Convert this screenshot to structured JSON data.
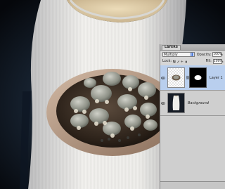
{
  "panel": {
    "tab_label": "LAYERS",
    "blend_mode": "Multiply",
    "opacity_label": "Opacity:",
    "opacity_value": "100%",
    "lock_label": "Lock:",
    "fill_label": "Fill:",
    "fill_value": "100%"
  },
  "layers": [
    {
      "name": "Layer 1",
      "selected": true,
      "has_mask": true
    },
    {
      "name": "Background",
      "selected": false,
      "has_mask": false
    }
  ],
  "colors": {
    "panel_bg": "#d6d6d6",
    "selection": "#b9cfee",
    "blend_arrows": "#4b79d8"
  }
}
